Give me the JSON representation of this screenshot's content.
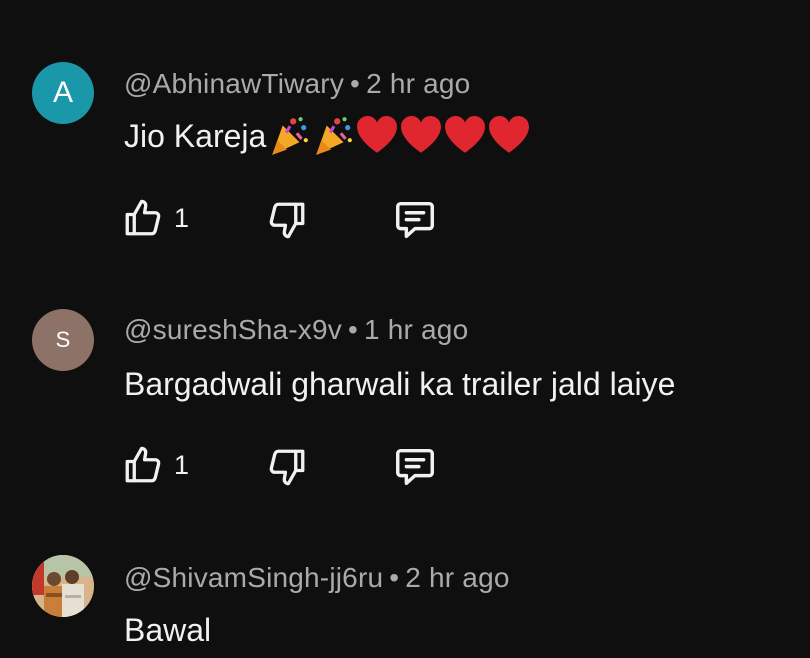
{
  "comments": [
    {
      "avatar_letter": "A",
      "avatar_color": "#1a97a8",
      "author": "@AbhinawTiwary",
      "separator": "•",
      "time": "2 hr ago",
      "text": "Jio Kareja",
      "emojis": [
        "party-popper-icon",
        "party-popper-icon",
        "red-heart-icon",
        "red-heart-icon",
        "red-heart-icon",
        "red-heart-icon"
      ],
      "like_count": "1"
    },
    {
      "avatar_letter": "S",
      "avatar_color": "#8d7268",
      "author": "@sureshSha-x9v",
      "separator": "•",
      "time": "1 hr ago",
      "text": "Bargadwali gharwali ka trailer jald laiye",
      "like_count": "1"
    },
    {
      "avatar_letter": "",
      "avatar_color": "#c9a27c",
      "author": "@ShivamSingh-jj6ru",
      "separator": "•",
      "time": "2 hr ago",
      "text": "Bawal"
    }
  ]
}
